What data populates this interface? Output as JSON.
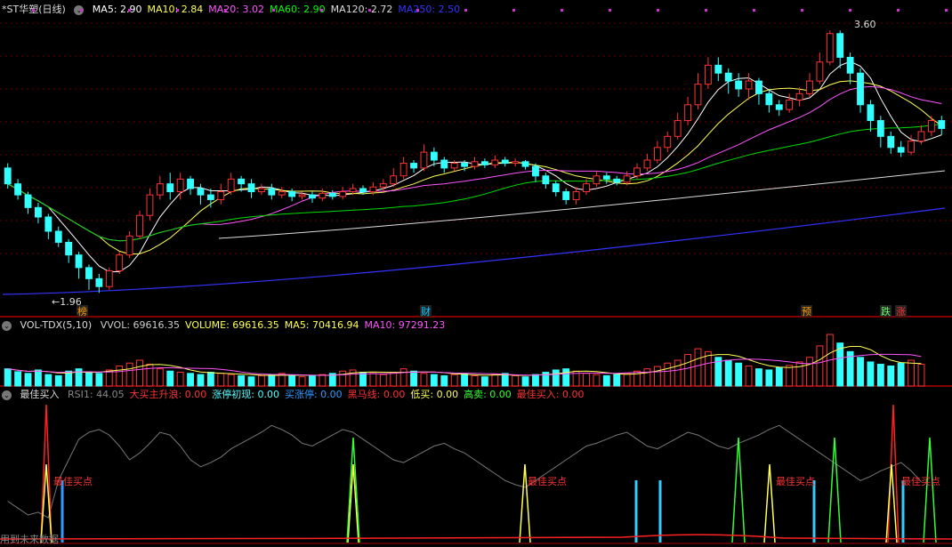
{
  "main": {
    "title": "*ST华塑(日线)",
    "ma": [
      {
        "label": "MA5: 2.90",
        "color": "#ffffff"
      },
      {
        "label": "MA10: 2.84",
        "color": "#ffff55"
      },
      {
        "label": "MA20: 3.02",
        "color": "#ff55ff"
      },
      {
        "label": "MA60: 2.90",
        "color": "#00ff00"
      },
      {
        "label": "MA120: 2.72",
        "color": "#dddddd"
      },
      {
        "label": "MA250: 2.50",
        "color": "#3333ff"
      }
    ],
    "high_label": "3.60",
    "low_label": "←1.96",
    "markers": [
      {
        "text": "榜",
        "color": "#ff9900",
        "x": 92
      },
      {
        "text": "财",
        "color": "#00ccff",
        "x": 478
      },
      {
        "text": "预",
        "color": "#ff9900",
        "x": 906
      },
      {
        "text": "跌",
        "color": "#66ff66",
        "x": 995
      },
      {
        "text": "涨",
        "color": "#ff3333",
        "x": 1012
      }
    ]
  },
  "volume": {
    "title": "VOL-TDX(5,10)",
    "items": [
      {
        "label": "VVOL: 69616.35",
        "color": "#cccccc"
      },
      {
        "label": "VOLUME: 69616.35",
        "color": "#ffff55"
      },
      {
        "label": "MA5: 70416.94",
        "color": "#ffff55"
      },
      {
        "label": "MA10: 97291.23",
        "color": "#ff55ff"
      }
    ]
  },
  "indicator": {
    "title": "最佳买入",
    "items": [
      {
        "label": "RSI1: 44.05",
        "color": "#888888"
      },
      {
        "label": "大买主升浪: 0.00",
        "color": "#ff3333"
      },
      {
        "label": "涨停初现: 0.00",
        "color": "#55ffff"
      },
      {
        "label": "买涨停: 0.00",
        "color": "#3399ff"
      },
      {
        "label": "黑马线: 0.00",
        "color": "#ff3333"
      },
      {
        "label": "低买: 0.00",
        "color": "#ffff55"
      },
      {
        "label": "高卖: 0.00",
        "color": "#33ff33"
      },
      {
        "label": "最佳买入: 0.00",
        "color": "#ff3333"
      }
    ],
    "buy_label": "最佳买点"
  },
  "footer_tip": "用到未来数据",
  "chart_data": {
    "type": "candlestick",
    "title": "*ST华塑(日线)",
    "y_range": [
      1.9,
      3.7
    ],
    "candles": [
      [
        2.75,
        2.65,
        2.78,
        2.62
      ],
      [
        2.65,
        2.58,
        2.68,
        2.55
      ],
      [
        2.58,
        2.5,
        2.6,
        2.46
      ],
      [
        2.5,
        2.44,
        2.53,
        2.4
      ],
      [
        2.44,
        2.35,
        2.46,
        2.3
      ],
      [
        2.35,
        2.28,
        2.38,
        2.25
      ],
      [
        2.28,
        2.2,
        2.3,
        2.15
      ],
      [
        2.2,
        2.12,
        2.22,
        2.05
      ],
      [
        2.12,
        2.05,
        2.14,
        1.98
      ],
      [
        2.05,
        2.0,
        2.08,
        1.96
      ],
      [
        2.0,
        2.1,
        2.12,
        1.98
      ],
      [
        2.1,
        2.2,
        2.22,
        2.08
      ],
      [
        2.2,
        2.32,
        2.35,
        2.18
      ],
      [
        2.32,
        2.45,
        2.48,
        2.3
      ],
      [
        2.45,
        2.58,
        2.62,
        2.42
      ],
      [
        2.58,
        2.65,
        2.7,
        2.55
      ],
      [
        2.65,
        2.6,
        2.72,
        2.55
      ],
      [
        2.6,
        2.68,
        2.72,
        2.55
      ],
      [
        2.68,
        2.62,
        2.7,
        2.58
      ],
      [
        2.62,
        2.58,
        2.65,
        2.52
      ],
      [
        2.58,
        2.55,
        2.62,
        2.5
      ],
      [
        2.55,
        2.6,
        2.65,
        2.52
      ],
      [
        2.6,
        2.68,
        2.72,
        2.58
      ],
      [
        2.68,
        2.65,
        2.7,
        2.6
      ],
      [
        2.65,
        2.6,
        2.68,
        2.56
      ],
      [
        2.6,
        2.62,
        2.65,
        2.58
      ],
      [
        2.62,
        2.58,
        2.65,
        2.55
      ],
      [
        2.58,
        2.6,
        2.63,
        2.56
      ],
      [
        2.6,
        2.57,
        2.62,
        2.54
      ],
      [
        2.57,
        2.58,
        2.6,
        2.55
      ],
      [
        2.58,
        2.56,
        2.6,
        2.53
      ],
      [
        2.56,
        2.59,
        2.62,
        2.54
      ],
      [
        2.59,
        2.57,
        2.61,
        2.55
      ],
      [
        2.57,
        2.6,
        2.63,
        2.55
      ],
      [
        2.6,
        2.62,
        2.65,
        2.58
      ],
      [
        2.62,
        2.6,
        2.64,
        2.58
      ],
      [
        2.6,
        2.63,
        2.66,
        2.58
      ],
      [
        2.63,
        2.65,
        2.68,
        2.6
      ],
      [
        2.65,
        2.7,
        2.75,
        2.63
      ],
      [
        2.7,
        2.78,
        2.82,
        2.68
      ],
      [
        2.78,
        2.75,
        2.8,
        2.72
      ],
      [
        2.75,
        2.85,
        2.9,
        2.73
      ],
      [
        2.85,
        2.8,
        2.88,
        2.76
      ],
      [
        2.8,
        2.75,
        2.82,
        2.72
      ],
      [
        2.75,
        2.78,
        2.8,
        2.73
      ],
      [
        2.78,
        2.76,
        2.8,
        2.73
      ],
      [
        2.76,
        2.79,
        2.82,
        2.74
      ],
      [
        2.79,
        2.77,
        2.81,
        2.75
      ],
      [
        2.77,
        2.8,
        2.83,
        2.75
      ],
      [
        2.8,
        2.78,
        2.82,
        2.76
      ],
      [
        2.78,
        2.79,
        2.81,
        2.76
      ],
      [
        2.79,
        2.76,
        2.8,
        2.74
      ],
      [
        2.76,
        2.7,
        2.78,
        2.66
      ],
      [
        2.7,
        2.65,
        2.72,
        2.62
      ],
      [
        2.65,
        2.6,
        2.67,
        2.57
      ],
      [
        2.6,
        2.55,
        2.62,
        2.52
      ],
      [
        2.55,
        2.6,
        2.63,
        2.52
      ],
      [
        2.6,
        2.65,
        2.68,
        2.58
      ],
      [
        2.65,
        2.7,
        2.73,
        2.63
      ],
      [
        2.7,
        2.68,
        2.72,
        2.65
      ],
      [
        2.68,
        2.66,
        2.7,
        2.64
      ],
      [
        2.66,
        2.7,
        2.73,
        2.64
      ],
      [
        2.7,
        2.75,
        2.78,
        2.68
      ],
      [
        2.75,
        2.8,
        2.84,
        2.73
      ],
      [
        2.8,
        2.88,
        2.92,
        2.78
      ],
      [
        2.88,
        2.95,
        2.98,
        2.85
      ],
      [
        2.95,
        3.05,
        3.1,
        2.93
      ],
      [
        3.05,
        3.15,
        3.2,
        3.02
      ],
      [
        3.15,
        3.28,
        3.35,
        3.12
      ],
      [
        3.28,
        3.4,
        3.45,
        3.25
      ],
      [
        3.4,
        3.35,
        3.45,
        3.3
      ],
      [
        3.35,
        3.3,
        3.38,
        3.22
      ],
      [
        3.3,
        3.25,
        3.35,
        3.2
      ],
      [
        3.25,
        3.3,
        3.35,
        3.18
      ],
      [
        3.3,
        3.22,
        3.32,
        3.15
      ],
      [
        3.22,
        3.15,
        3.25,
        3.1
      ],
      [
        3.15,
        3.12,
        3.18,
        3.08
      ],
      [
        3.12,
        3.18,
        3.22,
        3.1
      ],
      [
        3.18,
        3.22,
        3.26,
        3.14
      ],
      [
        3.22,
        3.3,
        3.35,
        3.2
      ],
      [
        3.3,
        3.42,
        3.48,
        3.28
      ],
      [
        3.42,
        3.6,
        3.62,
        3.4
      ],
      [
        3.6,
        3.45,
        3.62,
        3.38
      ],
      [
        3.45,
        3.35,
        3.48,
        3.28
      ],
      [
        3.35,
        3.15,
        3.38,
        3.1
      ],
      [
        3.15,
        3.05,
        3.18,
        2.98
      ],
      [
        3.05,
        2.95,
        3.08,
        2.88
      ],
      [
        2.95,
        2.88,
        2.98,
        2.84
      ],
      [
        2.88,
        2.85,
        2.92,
        2.82
      ],
      [
        2.85,
        2.92,
        2.96,
        2.83
      ],
      [
        2.92,
        2.98,
        3.02,
        2.9
      ],
      [
        2.98,
        3.05,
        3.08,
        2.95
      ],
      [
        3.05,
        3.0,
        3.08,
        2.96
      ]
    ],
    "volume": [
      30,
      25,
      22,
      28,
      20,
      18,
      26,
      30,
      24,
      22,
      28,
      35,
      40,
      45,
      38,
      30,
      26,
      24,
      22,
      20,
      24,
      22,
      20,
      18,
      16,
      18,
      20,
      22,
      18,
      16,
      18,
      20,
      22,
      26,
      28,
      24,
      22,
      20,
      24,
      30,
      26,
      22,
      20,
      18,
      20,
      22,
      18,
      16,
      20,
      22,
      18,
      16,
      20,
      24,
      28,
      30,
      26,
      22,
      20,
      18,
      20,
      22,
      26,
      30,
      34,
      40,
      45,
      55,
      65,
      60,
      50,
      45,
      40,
      35,
      30,
      28,
      32,
      36,
      42,
      50,
      70,
      90,
      75,
      60,
      50,
      42,
      38,
      35,
      40,
      45,
      38
    ],
    "rsi": [
      30,
      25,
      20,
      22,
      18,
      45,
      60,
      75,
      80,
      82,
      78,
      70,
      60,
      65,
      72,
      80,
      78,
      70,
      60,
      55,
      58,
      62,
      68,
      72,
      76,
      80,
      85,
      82,
      78,
      72,
      70,
      74,
      78,
      82,
      80,
      75,
      70,
      65,
      60,
      58,
      62,
      66,
      70,
      72,
      68,
      65,
      60,
      55,
      50,
      45,
      42,
      40,
      45,
      50,
      55,
      60,
      65,
      70,
      72,
      75,
      78,
      80,
      75,
      70,
      68,
      72,
      76,
      80,
      78,
      74,
      70,
      68,
      72,
      75,
      78,
      82,
      85,
      80,
      75,
      70,
      65,
      60,
      55,
      50,
      45,
      48,
      52,
      55,
      58,
      52,
      44
    ],
    "signals": {
      "best_buy_spikes": [
        52,
        1004
      ],
      "yellow_spikes": [
        52,
        397,
        590,
        865,
        1002
      ],
      "green_spikes": [
        397,
        830,
        938,
        1045
      ],
      "blue_bars": [
        70,
        715,
        742,
        915,
        1015
      ]
    }
  }
}
